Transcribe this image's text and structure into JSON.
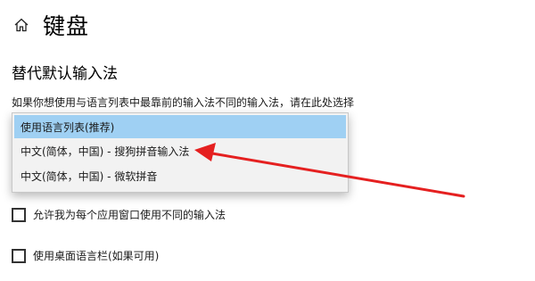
{
  "header": {
    "home_icon": "home-icon",
    "title": "键盘"
  },
  "section": {
    "title": "替代默认输入法",
    "description": "如果你想使用与语言列表中最靠前的输入法不同的输入法，请在此处选择"
  },
  "dropdown": {
    "options": [
      {
        "label": "使用语言列表(推荐)",
        "selected": true
      },
      {
        "label": "中文(简体，中国) - 搜狗拼音输入法",
        "selected": false
      },
      {
        "label": "中文(简体，中国) - 微软拼音",
        "selected": false
      }
    ]
  },
  "checkboxes": [
    {
      "label": "允许我为每个应用窗口使用不同的输入法",
      "checked": false
    },
    {
      "label": "使用桌面语言栏(如果可用)",
      "checked": false
    }
  ],
  "colors": {
    "selected_option_bg": "#9fd0f3",
    "annotation_arrow": "#e52020"
  }
}
